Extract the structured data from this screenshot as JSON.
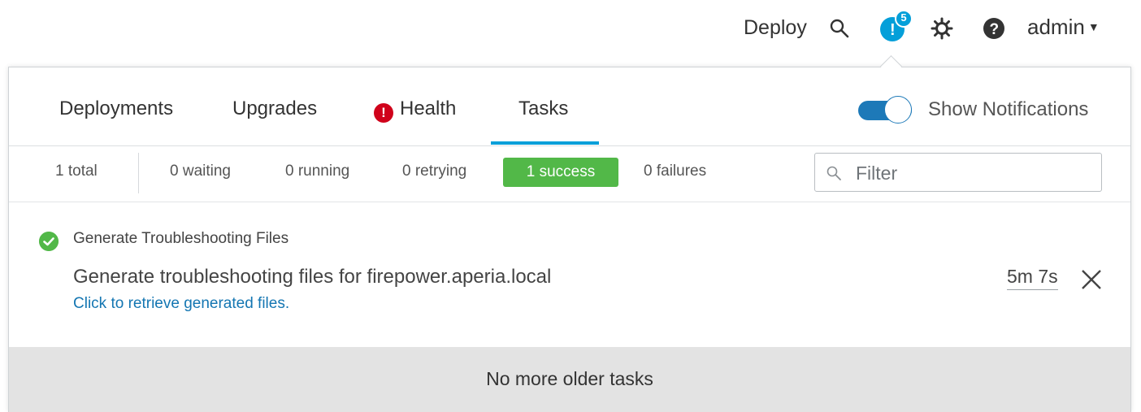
{
  "header": {
    "deploy_label": "Deploy",
    "notifications_count": "5",
    "user_label": "admin"
  },
  "tabs": [
    {
      "label": "Deployments"
    },
    {
      "label": "Upgrades"
    },
    {
      "label": "Health"
    },
    {
      "label": "Tasks"
    }
  ],
  "active_tab": "Tasks",
  "show_notifications": {
    "label": "Show Notifications",
    "enabled": true
  },
  "status": {
    "total": "1 total",
    "waiting": "0 waiting",
    "running": "0 running",
    "retrying": "0 retrying",
    "success": "1 success",
    "failures": "0 failures"
  },
  "filter": {
    "placeholder": "Filter",
    "value": ""
  },
  "task": {
    "title": "Generate Troubleshooting Files",
    "description": "Generate troubleshooting files for firepower.aperia.local",
    "link": "Click to retrieve generated files.",
    "elapsed": "5m 7s",
    "status": "success"
  },
  "footer": {
    "text": "No more older tasks"
  },
  "colors": {
    "accent": "#049fd9",
    "toggle": "#1d79b8",
    "success": "#52b848",
    "health_alert": "#d0021b",
    "link": "#1476b2",
    "footer_bg": "#e3e3e3"
  },
  "icons": [
    "search-icon",
    "notification-icon",
    "gear-icon",
    "help-icon",
    "alert-icon",
    "search-icon",
    "check-circle-icon",
    "close-icon"
  ]
}
